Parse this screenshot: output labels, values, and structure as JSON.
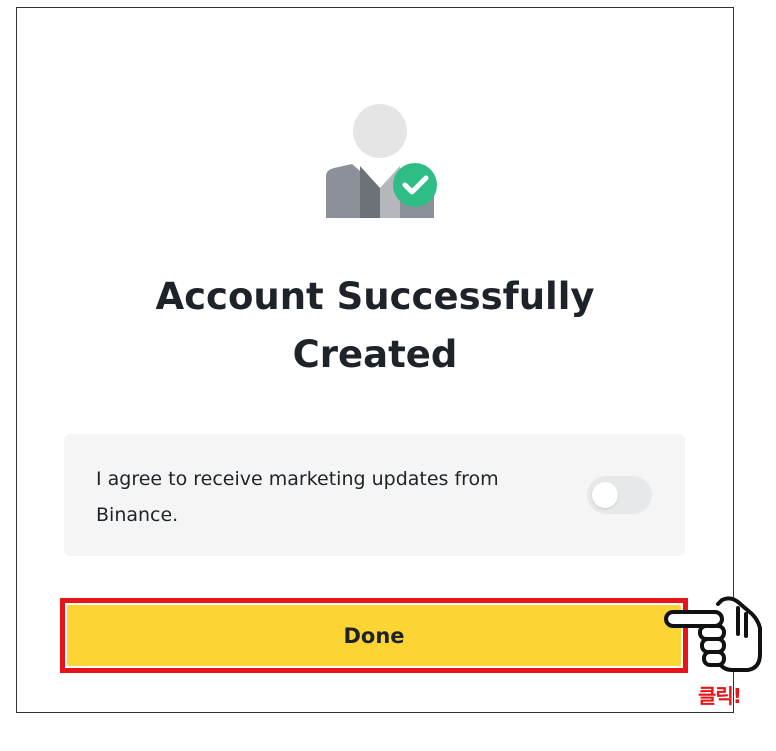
{
  "dialog": {
    "title_line1": "Account Successfully",
    "title_line2": "Created",
    "avatar_icon": "user-check-icon",
    "marketing": {
      "text": "I agree to receive marketing updates from Binance.",
      "toggle_on": false
    },
    "done_label": "Done"
  },
  "annotation": {
    "pointer_icon": "pointing-hand-icon",
    "click_label": "클릭!"
  },
  "colors": {
    "primary_button": "#fcd535",
    "success_check": "#2ebd85",
    "highlight_border": "#e8141a",
    "title_text": "#1e2329",
    "card_background": "#f5f5f5"
  }
}
